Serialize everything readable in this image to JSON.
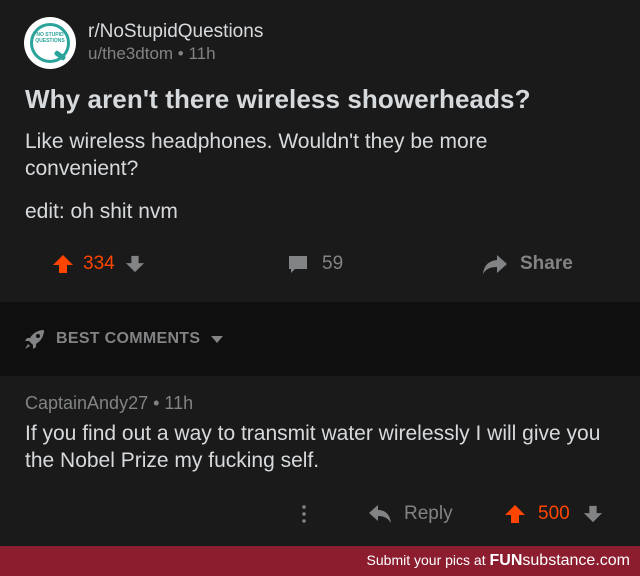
{
  "post": {
    "subreddit": "r/NoStupidQuestions",
    "logo_text": "NO STUPID QUESTIONS",
    "author": "u/the3dtom",
    "age": "11h",
    "title": "Why aren't there wireless showerheads?",
    "body": "Like wireless headphones. Wouldn't they be more convenient?",
    "edit": "edit: oh shit nvm",
    "score": "334",
    "comment_count": "59",
    "share_label": "Share"
  },
  "sort": {
    "label": "BEST COMMENTS"
  },
  "comment": {
    "author": "CaptainAndy27",
    "age": "11h",
    "body": "If you find out a way to transmit water wirelessly I will give you the Nobel Prize my fucking self.",
    "reply_label": "Reply",
    "score": "500"
  },
  "footer": {
    "text": "Submit your pics at",
    "brand_bold": "FUN",
    "brand_light": "substance.com"
  },
  "colors": {
    "upvote": "#ff4500",
    "background": "#1a1a1b",
    "sort_bar": "#0f0f10",
    "muted": "#818384",
    "footer": "#8c1d2f"
  },
  "icons": [
    "upvote-arrow-icon",
    "downvote-arrow-icon",
    "comment-bubble-icon",
    "share-arrow-icon",
    "rocket-icon",
    "caret-down-icon",
    "more-dots-icon",
    "reply-arrow-icon"
  ]
}
